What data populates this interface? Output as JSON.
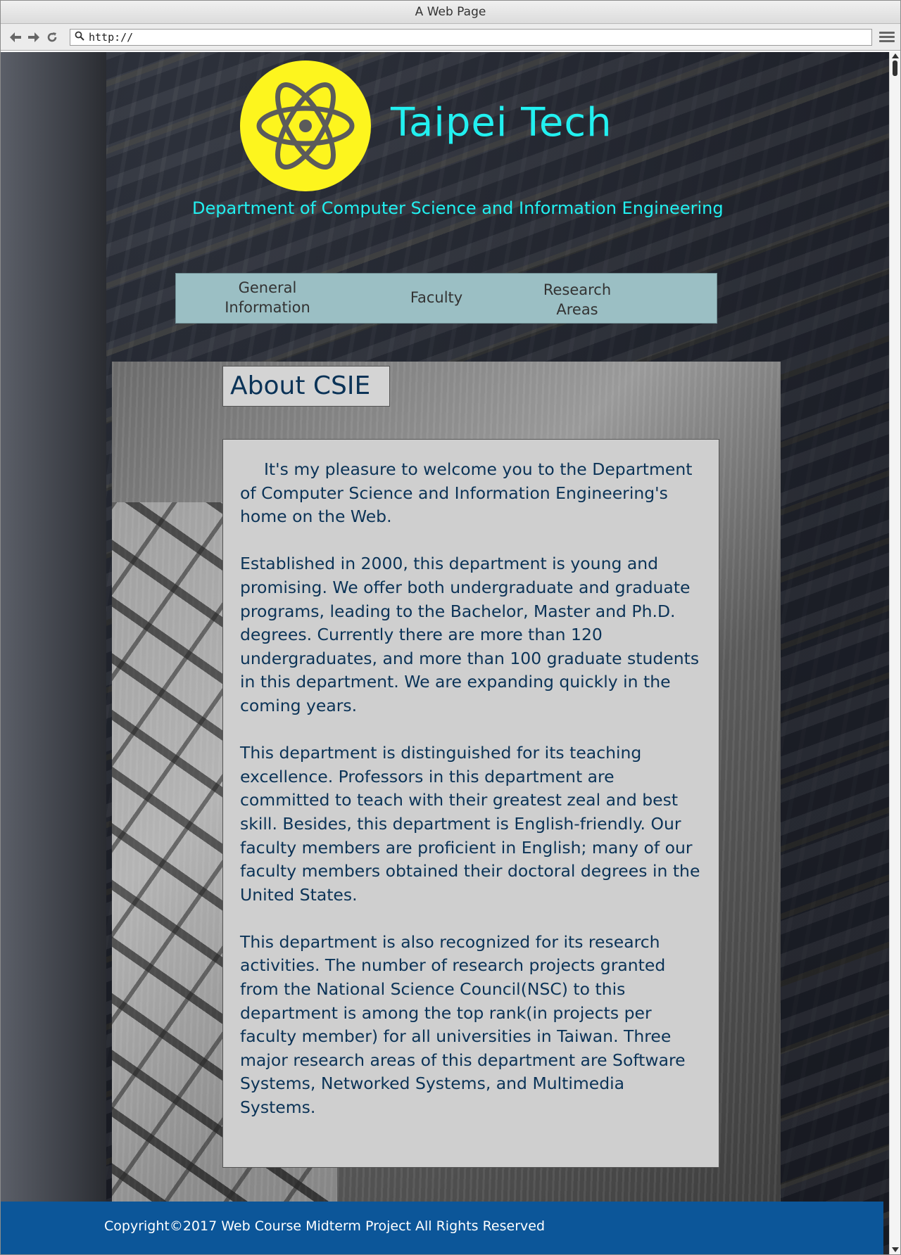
{
  "window": {
    "title": "A Web Page"
  },
  "toolbar": {
    "url": "http://",
    "icons": [
      "back-arrow-icon",
      "forward-arrow-icon",
      "reload-icon",
      "search-icon",
      "hamburger-menu-icon"
    ]
  },
  "header": {
    "logo_icon": "atom-icon",
    "title": "Taipei Tech",
    "subtitle": "Department of Computer Science and Information Engineering"
  },
  "nav": {
    "items": [
      {
        "label_line1": "General",
        "label_line2": "Information"
      },
      {
        "label_line1": "Faculty",
        "label_line2": ""
      },
      {
        "label_line1": "Research",
        "label_line2": "Areas"
      }
    ]
  },
  "main": {
    "heading": "About CSIE",
    "paragraphs": [
      "It's my pleasure to welcome you to the Department of Computer Science and Information Engineering's home on the Web.",
      "Established in 2000, this department is young and promising. We offer both undergraduate and graduate programs, leading to the Bachelor, Master and Ph.D. degrees. Currently there are more than 120 undergraduates, and more than 100 graduate students in this department. We are expanding quickly in the coming years.",
      "This department is distinguished for its teaching excellence. Professors in this department are committed to teach with their greatest zeal and best skill. Besides, this department is English-friendly. Our faculty members are proficient in English; many of our faculty members obtained their doctoral degrees in the United States.",
      "This department is also recognized for its research activities. The number of research projects granted from the National Science Council(NSC) to this department is among the top rank(in projects per faculty member) for all universities in Taiwan. Three major research areas of this department are Software Systems, Networked Systems, and Multimedia Systems."
    ]
  },
  "footer": {
    "text": "Copyright©2017 Web Course Midterm Project  All Rights Reserved"
  },
  "colors": {
    "title": "#22f0f0",
    "logo_bg": "#fdf51e",
    "nav_bg": "#9bbfc4",
    "content_text": "#0b3357",
    "footer_bg": "#0c5699"
  }
}
